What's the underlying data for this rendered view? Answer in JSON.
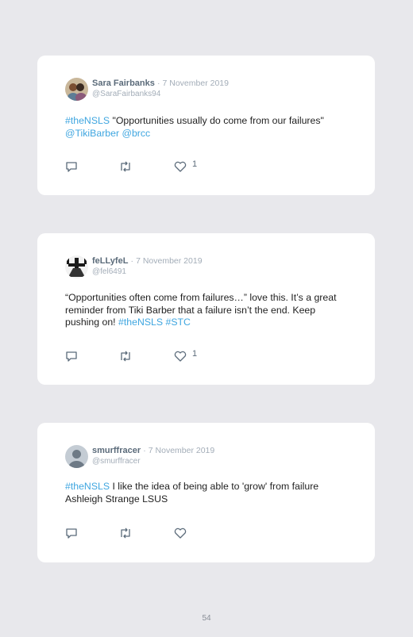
{
  "tweets": [
    {
      "name": "Sara Fairbanks",
      "date": "7 November 2019",
      "handle": "@SaraFairbanks94",
      "body": [
        {
          "text": "#theNSLS",
          "link": true
        },
        {
          "text": " \"Opportunities usually do come from our failures\" ",
          "link": false
        },
        {
          "text": "@TikiBarber @brcc",
          "link": true
        }
      ],
      "likes": "1"
    },
    {
      "name": "feLLyfeL",
      "date": "7 November 2019",
      "handle": "@fel6491",
      "body": [
        {
          "text": "“Opportunities often come from failures…” love this. It’s a great reminder from Tiki Barber that a failure isn’t the end. Keep pushing on! ",
          "link": false
        },
        {
          "text": "#theNSLS #STC",
          "link": true
        }
      ],
      "likes": "1"
    },
    {
      "name": "smurffracer",
      "date": "7 November 2019",
      "handle": "@smurffracer",
      "body": [
        {
          "text": "#theNSLS",
          "link": true
        },
        {
          "text": " I like the idea of being able to 'grow' from failure Ashleigh Strange LSUS",
          "link": false
        }
      ],
      "likes": ""
    }
  ],
  "separator": "·",
  "page_number": "54",
  "icons": {
    "reply": "reply-icon",
    "retweet": "retweet-icon",
    "like": "heart-icon"
  },
  "colors": {
    "link": "#3fa6e0",
    "name": "#5b6b7a",
    "meta": "#a3adb8",
    "card": "#ffffff",
    "background": "#e8e8ec"
  }
}
